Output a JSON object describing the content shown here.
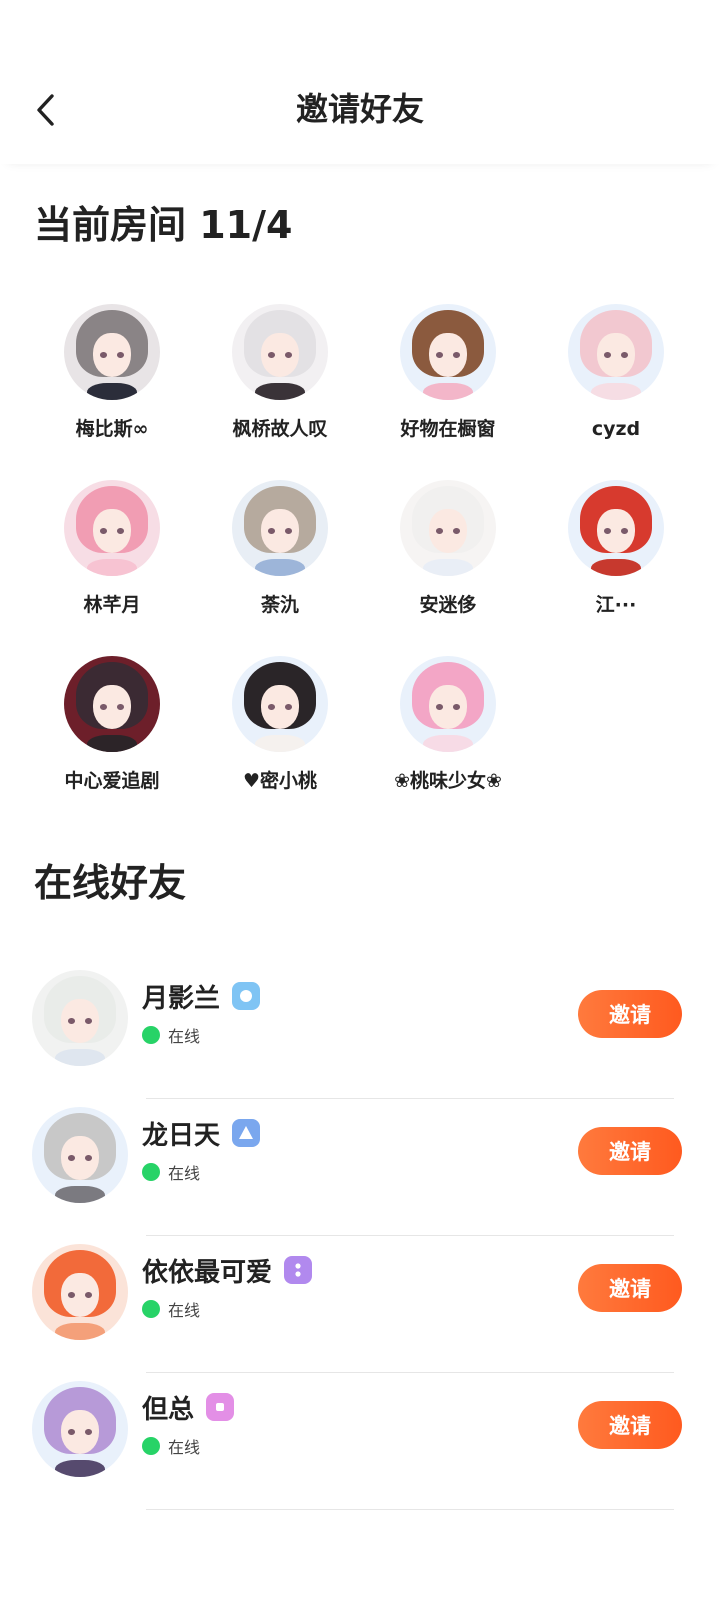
{
  "header": {
    "title": "邀请好友",
    "back_icon": "chevron-left-icon"
  },
  "room": {
    "title": "当前房间 11/4",
    "members": [
      {
        "name": "梅比斯∞",
        "hair": "#8a8486",
        "bg": "#e8e4e6",
        "body": "#2b2d3a"
      },
      {
        "name": "枫桥故人叹",
        "hair": "#e3e1e4",
        "bg": "#f2f0f2",
        "body": "#3a3338"
      },
      {
        "name": "好物在橱窗",
        "hair": "#8b5a3e",
        "bg": "#e9f1fb",
        "body": "#f3b6c9"
      },
      {
        "name": "cyzd",
        "hair": "#f2c8d0",
        "bg": "#e9f1fb",
        "body": "#f6dde4"
      },
      {
        "name": "林芊月",
        "hair": "#f19db3",
        "bg": "#f7dde5",
        "body": "#f7c3d2"
      },
      {
        "name": "荼氿",
        "hair": "#b6aa9e",
        "bg": "#e8eef5",
        "body": "#9db5d9"
      },
      {
        "name": "安迷侈",
        "hair": "#f1f0ef",
        "bg": "#f6f4f3",
        "body": "#e9eef6"
      },
      {
        "name": "江···",
        "hair": "#d73a2e",
        "bg": "#e9f1fb",
        "body": "#c7392e"
      },
      {
        "name": "中心爱追剧",
        "hair": "#3b2a33",
        "bg": "#6d1f2a",
        "body": "#2c2428"
      },
      {
        "name": "♥密小桃",
        "hair": "#2a2528",
        "bg": "#e9f1fb",
        "body": "#f5f1ee"
      },
      {
        "name": "❀桃味少女❀",
        "hair": "#f3a6c6",
        "bg": "#e9f1fb",
        "body": "#f7dbe6"
      }
    ]
  },
  "online": {
    "title": "在线好友",
    "friends": [
      {
        "name": "月影兰",
        "status": "在线",
        "action": "邀请",
        "badge_icon": "level-circle-badge-icon",
        "badge_color": "#7fc4f4",
        "hair": "#e9ece9",
        "bg": "#f1f2f1",
        "body": "#dfe6ef"
      },
      {
        "name": "龙日天",
        "status": "在线",
        "action": "邀请",
        "badge_icon": "level-triangle-badge-icon",
        "badge_color": "#7aa7ee",
        "hair": "#c8c8c8",
        "bg": "#e9f1fb",
        "body": "#7b7a80"
      },
      {
        "name": "依依最可爱",
        "status": "在线",
        "action": "邀请",
        "badge_icon": "level-dots-badge-icon",
        "badge_color": "#b189ee",
        "hair": "#f26a3a",
        "bg": "#fbe3d8",
        "body": "#f4a07a"
      },
      {
        "name": "但总",
        "status": "在线",
        "action": "邀请",
        "badge_icon": "level-square-badge-icon",
        "badge_color": "#e38fe6",
        "hair": "#b79ad8",
        "bg": "#e9f1fb",
        "body": "#564a6e"
      }
    ]
  }
}
